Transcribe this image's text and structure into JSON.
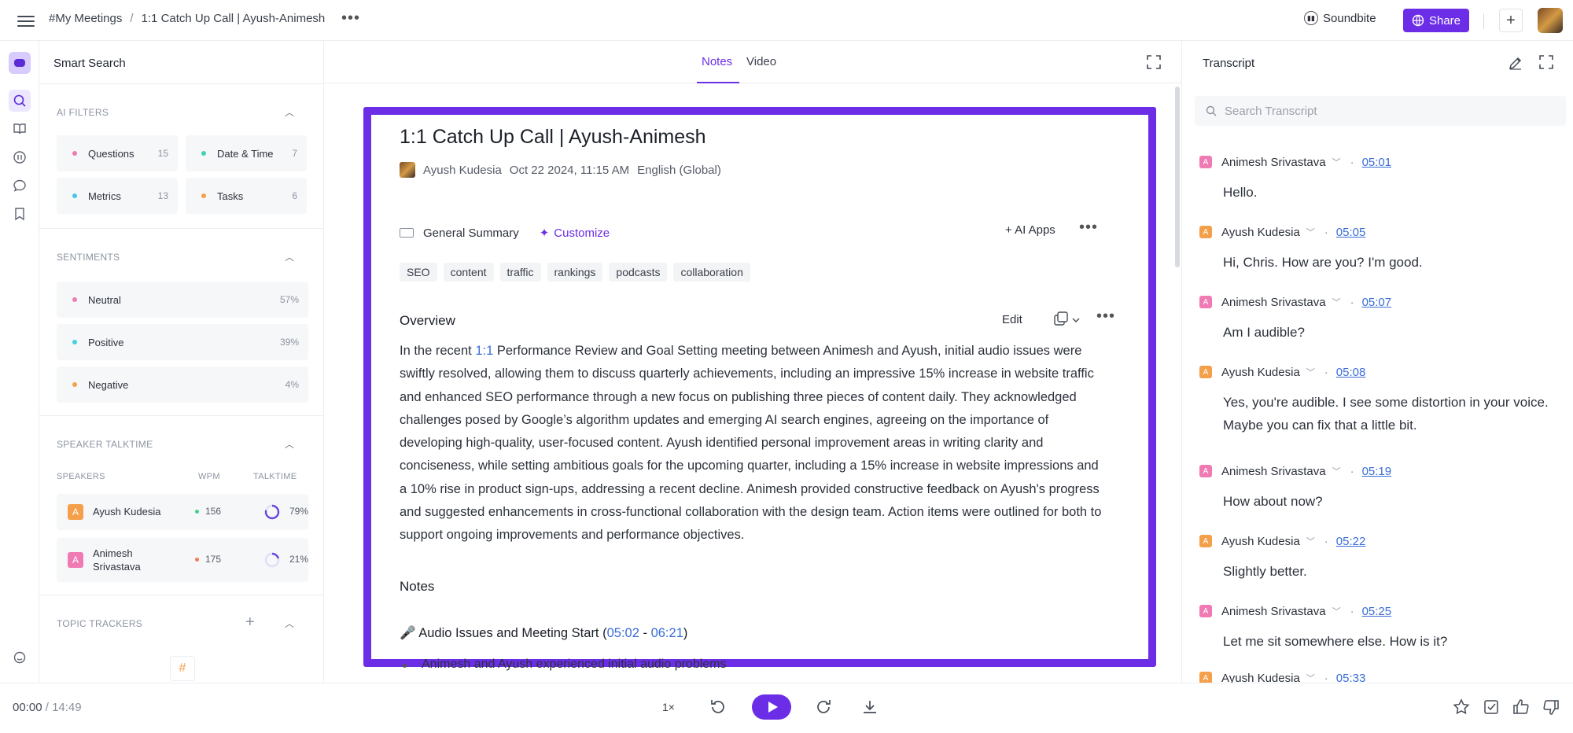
{
  "topbar": {
    "breadcrumb": [
      "#My Meetings",
      "1:1 Catch Up Call | Ayush-Animesh"
    ],
    "breadcrumb_sep": "/",
    "soundbite_label": "Soundbite",
    "share_label": "Share"
  },
  "left": {
    "title": "Smart Search",
    "ai_filters_label": "AI FILTERS",
    "ai_filters": [
      {
        "label": "Questions",
        "count": "15",
        "dot": "#f07bb4"
      },
      {
        "label": "Date & Time",
        "count": "7",
        "dot": "#3fd3b8"
      },
      {
        "label": "Metrics",
        "count": "13",
        "dot": "#46c6ea"
      },
      {
        "label": "Tasks",
        "count": "6",
        "dot": "#f4a04a"
      }
    ],
    "sentiments_label": "SENTIMENTS",
    "sentiments": [
      {
        "label": "Neutral",
        "pct": "57%",
        "dot": "#f07bb4"
      },
      {
        "label": "Positive",
        "pct": "39%",
        "dot": "#3fd3e0"
      },
      {
        "label": "Negative",
        "pct": "4%",
        "dot": "#f4a04a"
      }
    ],
    "talktime_label": "SPEAKER TALKTIME",
    "col_speakers": "SPEAKERS",
    "col_wpm": "WPM",
    "col_talktime": "TALKTIME",
    "speakers": [
      {
        "badge": "A",
        "name": "Ayush Kudesia",
        "wpm": "156",
        "pct": "79%",
        "fraction": 0.79,
        "color": "#f4a04a",
        "wpm_dot": "#3fd38a"
      },
      {
        "badge": "A",
        "name": "Animesh Srivastava",
        "wpm": "175",
        "pct": "21%",
        "fraction": 0.21,
        "color": "#f07bb4",
        "wpm_dot": "#f07b5a"
      }
    ],
    "topic_label": "TOPIC TRACKERS",
    "hash": "#"
  },
  "mid": {
    "tabs": [
      "Notes",
      "Video"
    ],
    "title": "1:1 Catch Up Call | Ayush-Animesh",
    "author": "Ayush Kudesia",
    "date": "Oct 22 2024, 11:15 AM",
    "language": "English (Global)",
    "summary_label": "General Summary",
    "customize_label": "Customize",
    "ai_apps_label": "+ AI Apps",
    "tags": [
      "SEO",
      "content",
      "traffic",
      "rankings",
      "podcasts",
      "collaboration"
    ],
    "overview_title": "Overview",
    "edit_label": "Edit",
    "overview_pre": "In the recent ",
    "overview_link": "1:1",
    "overview_post": " Performance Review and Goal Setting meeting between Animesh and Ayush, initial audio issues were swiftly resolved, allowing them to discuss quarterly achievements, including an impressive 15% increase in website traffic and enhanced SEO performance through a new focus on publishing three pieces of content daily. They acknowledged challenges posed by Google’s algorithm updates and emerging AI search engines, agreeing on the importance of developing high-quality, user-focused content. Ayush identified personal improvement areas in writing clarity and conciseness, while setting ambitious goals for the upcoming quarter, including a 15% increase in website impressions and a 10% rise in product sign-ups, addressing a recent decline. Animesh provided constructive feedback on Ayush's progress and suggested enhancements in cross-functional collaboration with the design team. Action items were outlined for both to support ongoing improvements and performance objectives.",
    "notes_title": "Notes",
    "note_heading": "🎤 Audio Issues and Meeting Start (",
    "note_start": "05:02",
    "note_dash": " - ",
    "note_end": "06:21",
    "note_close": ")",
    "bullet_partial": "Animesh and Ayush experienced initial audio problems"
  },
  "right": {
    "title": "Transcript",
    "search_placeholder": "Search Transcript",
    "entries": [
      {
        "badge": "A",
        "color": "#f07bb4",
        "speaker": "Animesh Srivastava",
        "time": "05:01",
        "text": "Hello."
      },
      {
        "badge": "A",
        "color": "#f4a04a",
        "speaker": "Ayush Kudesia",
        "time": "05:05",
        "text": "Hi, Chris. How are you? I'm good."
      },
      {
        "badge": "A",
        "color": "#f07bb4",
        "speaker": "Animesh Srivastava",
        "time": "05:07",
        "text": "Am I audible?"
      },
      {
        "badge": "A",
        "color": "#f4a04a",
        "speaker": "Ayush Kudesia",
        "time": "05:08",
        "text": "Yes, you're audible. I see some distortion in your voice. Maybe you can fix that a little bit."
      },
      {
        "badge": "A",
        "color": "#f07bb4",
        "speaker": "Animesh Srivastava",
        "time": "05:19",
        "text": "How about now?"
      },
      {
        "badge": "A",
        "color": "#f4a04a",
        "speaker": "Ayush Kudesia",
        "time": "05:22",
        "text": "Slightly better."
      },
      {
        "badge": "A",
        "color": "#f07bb4",
        "speaker": "Animesh Srivastava",
        "time": "05:25",
        "text": "Let me sit somewhere else. How is it?"
      },
      {
        "badge": "A",
        "color": "#f4a04a",
        "speaker": "Ayush Kudesia",
        "time": "05:33",
        "text": ""
      }
    ]
  },
  "player": {
    "current": "00:00",
    "sep": " / ",
    "total": "14:49",
    "speed": "1×"
  }
}
